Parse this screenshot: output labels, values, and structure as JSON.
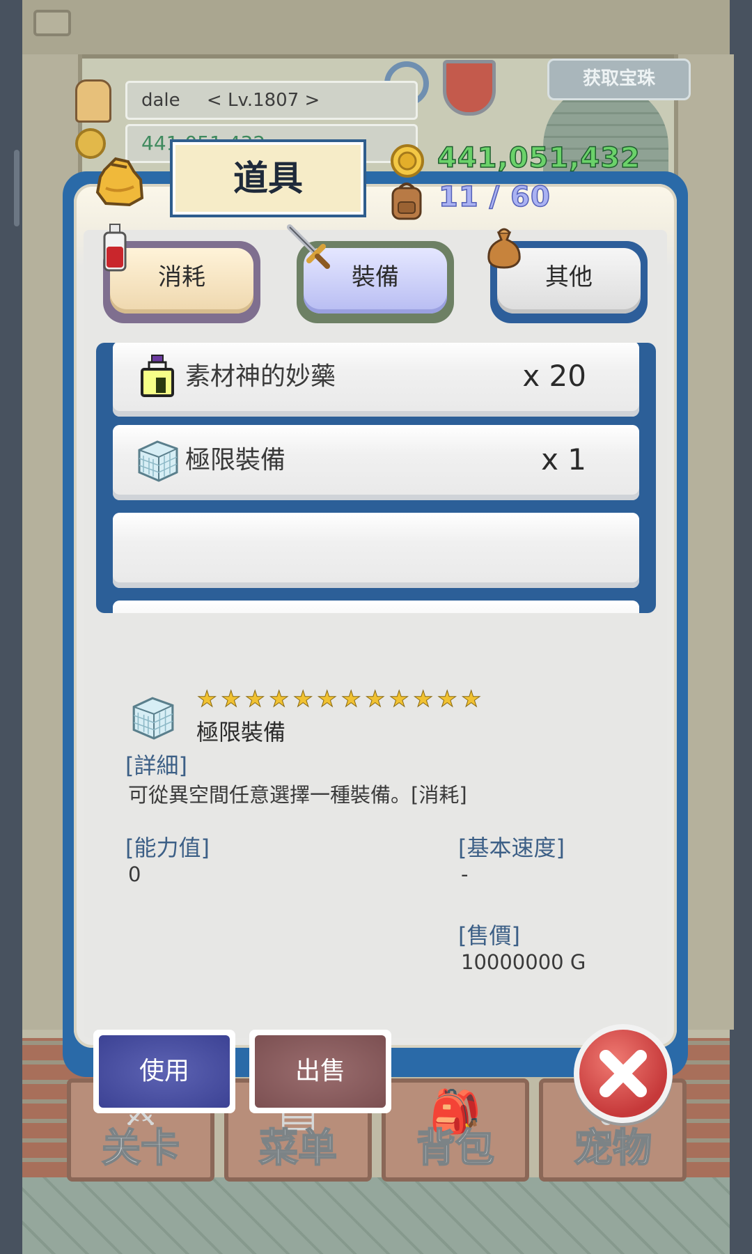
{
  "player": {
    "name": "dale",
    "level": "< Lv.1807 >",
    "money_preview": "441,051,432"
  },
  "top_badge": "获取宝珠",
  "dialog": {
    "title": "道具",
    "gold": "441,051,432",
    "capacity": "11 / 60"
  },
  "tabs": {
    "consume": "消耗",
    "equip": "裝備",
    "other": "其他",
    "selected": "裝備"
  },
  "items": [
    {
      "name": "素材神的妙藥",
      "qty": "x 20",
      "icon": "potion-bottle-icon"
    },
    {
      "name": "極限裝備",
      "qty": "x 1",
      "icon": "ice-cube-icon"
    },
    {
      "name": "",
      "qty": "",
      "icon": ""
    }
  ],
  "detail": {
    "stars": [
      "★",
      "★",
      "★",
      "★",
      "★",
      "★",
      "★",
      "★",
      "★",
      "★",
      "★",
      "★"
    ],
    "name": "極限裝備",
    "desc_heading": "[詳細]",
    "desc": "可從異空間任意選擇一種裝備。[消耗]",
    "power_heading": "[能力值]",
    "power_value": "0",
    "speed_heading": "[基本速度]",
    "speed_value": "-",
    "price_heading": "[售價]",
    "price_value": "10000000 G"
  },
  "buttons": {
    "use": "使用",
    "sell": "出售"
  },
  "nav": {
    "stage": "关卡",
    "menu": "菜单",
    "bag": "背包",
    "pet": "宠物"
  },
  "colors": {
    "dialog_frame": "#2a6aa8",
    "gold_text": "#6bd26a",
    "capacity_text": "#aab2f2",
    "heading_text": "#3c5f86"
  }
}
